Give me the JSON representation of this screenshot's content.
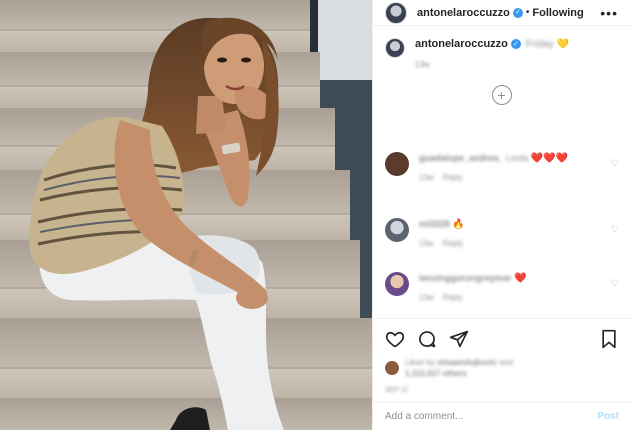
{
  "post": {
    "author": "antonelaroccuzzo",
    "follow_separator": "•",
    "follow_label": "Following",
    "more_label": "•••"
  },
  "caption": {
    "author": "antonelaroccuzzo",
    "text": "Friday",
    "emoji": "💛",
    "timestamp": "13w"
  },
  "load_more_label": "+",
  "comments": [
    {
      "user": "guadalupe_andrea_",
      "text": "Linda",
      "emoji": "❤️❤️❤️",
      "time": "13w",
      "reply": "Reply"
    },
    {
      "user": "mi3328",
      "text": "",
      "emoji": "🔥",
      "time": "13w",
      "reply": "Reply"
    },
    {
      "user": "tenzinggurungreymar",
      "text": "",
      "emoji": "❤️",
      "time": "13w",
      "reply": "Reply"
    }
  ],
  "likes": {
    "text_prefix": "Liked by",
    "first_user": "ninaamilujkovic",
    "text_and": "and",
    "others": "1,112,417 others"
  },
  "post_timestamp": "SEP 11",
  "add_comment": {
    "placeholder": "Add a comment...",
    "post_label": "Post"
  }
}
